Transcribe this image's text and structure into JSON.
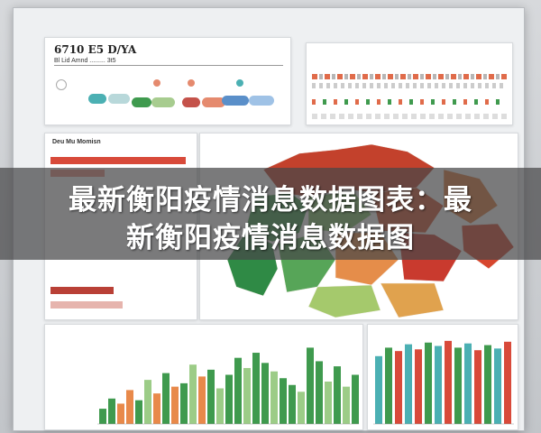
{
  "overlay": {
    "line1": "最新衡阳疫情消息数据图表：最",
    "line2": "新衡阳疫情消息数据图"
  },
  "header": {
    "title": "6710 E5 D/YA",
    "subtitle": "Bl Lid Amnd ......... 3t5"
  },
  "colors": {
    "red": "#d84a3a",
    "orange": "#e8894a",
    "green": "#3f9a4e",
    "light_green": "#9ccc87",
    "teal": "#4bb0b3",
    "blue": "#5a8fc9"
  },
  "side": {
    "title": "Deu Mu Momisn"
  },
  "bars1_values": [
    18,
    30,
    24,
    40,
    28,
    52,
    36,
    60,
    44,
    48,
    70,
    56,
    64,
    42,
    58,
    78,
    66,
    84,
    72,
    62,
    54,
    46,
    38,
    90,
    74,
    50,
    68,
    44,
    58
  ],
  "bars1_colors": [
    "green",
    "green",
    "orange",
    "orange",
    "green",
    "light_green",
    "orange",
    "green",
    "orange",
    "green",
    "light_green",
    "orange",
    "green",
    "light_green",
    "green",
    "green",
    "light_green",
    "green",
    "green",
    "light_green",
    "green",
    "green",
    "light_green",
    "green",
    "green",
    "light_green",
    "green",
    "light_green",
    "green"
  ],
  "bars2_values": [
    80,
    90,
    86,
    94,
    88,
    96,
    92,
    98,
    90,
    95,
    87,
    93,
    89,
    97
  ],
  "bars2_colors": [
    "teal",
    "green",
    "red",
    "teal",
    "red",
    "green",
    "teal",
    "red",
    "green",
    "teal",
    "red",
    "green",
    "teal",
    "red"
  ]
}
